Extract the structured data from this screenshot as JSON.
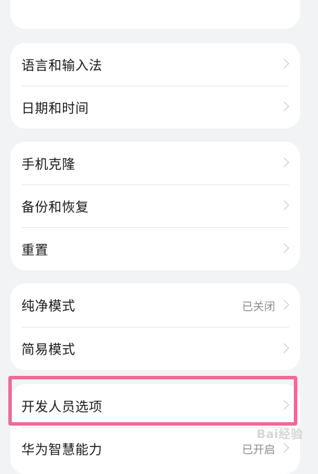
{
  "settings": {
    "top_partial_label": "",
    "group1": [
      {
        "label": "语言和输入法"
      },
      {
        "label": "日期和时间"
      }
    ],
    "group2": [
      {
        "label": "手机克隆"
      },
      {
        "label": "备份和恢复"
      },
      {
        "label": "重置"
      }
    ],
    "group3": [
      {
        "label": "纯净模式",
        "value": "已关闭"
      },
      {
        "label": "简易模式"
      }
    ],
    "group4": [
      {
        "label": "开发人员选项"
      },
      {
        "label": "华为智慧能力",
        "value": "已开启"
      }
    ]
  },
  "watermark": "Bai经验",
  "colors": {
    "background": "#f1f3f5",
    "card": "#ffffff",
    "highlight": "#f06a96",
    "text": "#1a1a1a",
    "secondary_text": "#8c8c8c"
  }
}
